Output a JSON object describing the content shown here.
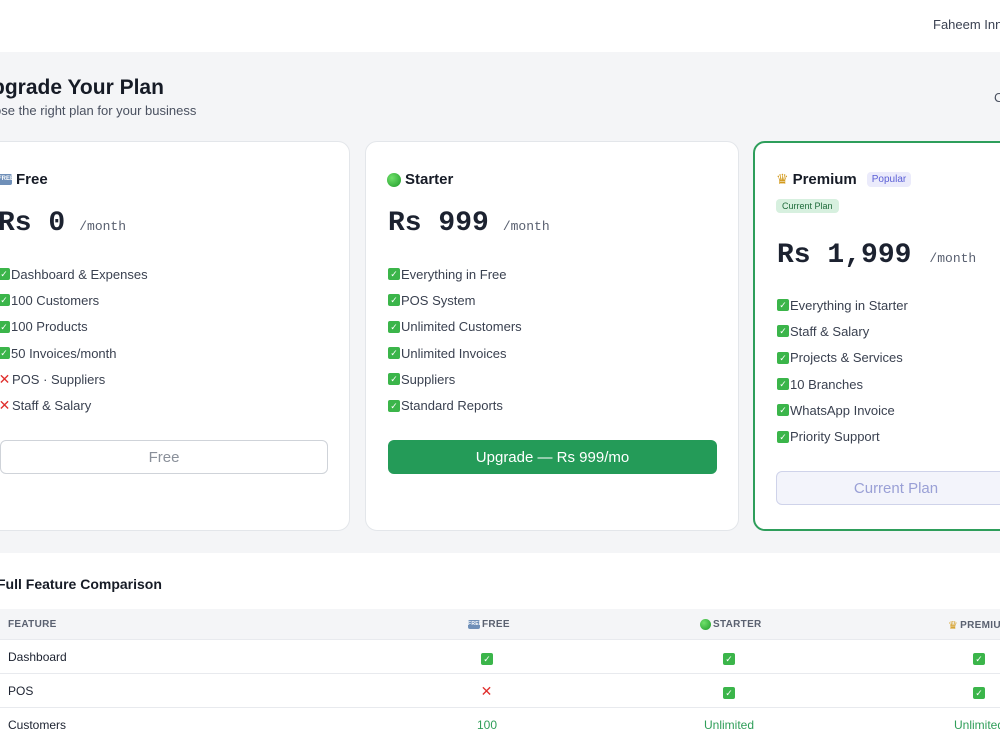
{
  "header": {
    "user_name": "Faheem Inn"
  },
  "page": {
    "title": "Upgrade Your Plan",
    "title_visible": "pgrade Your Plan",
    "subtitle": "ose the right plan for your business",
    "corner_char": "C"
  },
  "plans": [
    {
      "icon": "free-icon",
      "icon_text": "FREE",
      "name": "Free",
      "price": "Rs 0",
      "period": "/month",
      "features": [
        {
          "text": "Dashboard & Expenses",
          "included": true
        },
        {
          "text": "100 Customers",
          "included": true
        },
        {
          "text": "100 Products",
          "included": true
        },
        {
          "text": "50 Invoices/month",
          "included": true
        },
        {
          "text": "POS · Suppliers",
          "included": false
        },
        {
          "text": "Staff & Salary",
          "included": false
        }
      ],
      "button": "Free"
    },
    {
      "icon": "green-circle-icon",
      "name": "Starter",
      "price": "Rs 999",
      "period": "/month",
      "features": [
        {
          "text": "Everything in Free",
          "included": true
        },
        {
          "text": "POS System",
          "included": true
        },
        {
          "text": "Unlimited Customers",
          "included": true
        },
        {
          "text": "Unlimited Invoices",
          "included": true
        },
        {
          "text": "Suppliers",
          "included": true
        },
        {
          "text": "Standard Reports",
          "included": true
        }
      ],
      "button": "Upgrade — Rs 999/mo"
    },
    {
      "icon": "crown-icon",
      "name": "Premium",
      "badge": "Popular",
      "current_badge": "Current Plan",
      "price": "Rs 1,999",
      "period": "/month",
      "features": [
        {
          "text": "Everything in Starter",
          "included": true
        },
        {
          "text": "Staff & Salary",
          "included": true
        },
        {
          "text": "Projects & Services",
          "included": true
        },
        {
          "text": "10 Branches",
          "included": true
        },
        {
          "text": "WhatsApp Invoice",
          "included": true
        },
        {
          "text": "Priority Support",
          "included": true
        }
      ],
      "button": "Current Plan"
    }
  ],
  "comparison": {
    "title": "Full Feature Comparison",
    "columns": [
      "FEATURE",
      "FREE",
      "STARTER",
      "PREMIU"
    ],
    "rows": [
      {
        "feature": "Dashboard",
        "free": "check",
        "starter": "check",
        "premium": "check"
      },
      {
        "feature": "POS",
        "free": "cross",
        "starter": "check",
        "premium": "check"
      },
      {
        "feature": "Customers",
        "free": "100",
        "starter": "Unlimited",
        "premium": "Unlimited"
      }
    ]
  },
  "colors": {
    "accent_green": "#249b58",
    "check_green": "#3bb54a",
    "cross_red": "#e0302d",
    "badge_purple": "#5b5fd6"
  }
}
